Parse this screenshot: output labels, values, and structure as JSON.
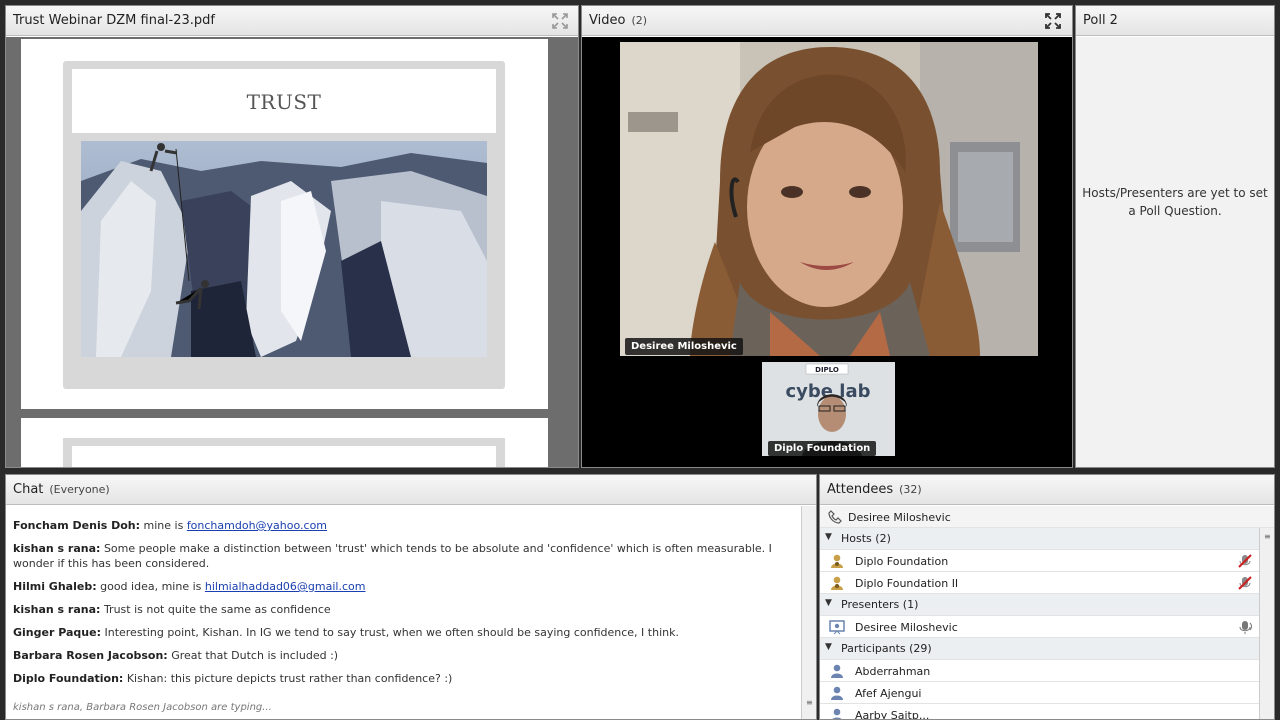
{
  "share_pod": {
    "title": "Trust Webinar DZM final-23.pdf",
    "slide_title": "TRUST"
  },
  "video_pod": {
    "title": "Video",
    "count": "(2)",
    "main_name": "Desiree Miloshevic",
    "thumb_name": "Diplo Foundation",
    "thumb_sign": "cybe lab"
  },
  "poll_pod": {
    "title": "Poll 2",
    "message": "Hosts/Presenters are yet to set a Poll Question."
  },
  "chat_pod": {
    "title": "Chat",
    "scope": "(Everyone)",
    "messages": [
      {
        "sender": "Foncham Denis Doh:",
        "text": "mine is ",
        "link": "fonchamdoh@yahoo.com"
      },
      {
        "sender": "kishan s rana:",
        "text": "Some people make a distinction between 'trust' which tends to be absolute and 'confidence' which is often measurable. I wonder if this has been considered."
      },
      {
        "sender": "Hilmi Ghaleb:",
        "text": "good idea, mine is ",
        "link": "hilmialhaddad06@gmail.com"
      },
      {
        "sender": "kishan s rana:",
        "text": "Trust is not quite the same as confidence"
      },
      {
        "sender": "Ginger Paque:",
        "text": "Interesting point, Kishan. In IG we tend to say trust, when we often should be saying confidence, I think."
      },
      {
        "sender": "Barbara Rosen Jacobson:",
        "text": "Great that Dutch is included :)"
      },
      {
        "sender": "Diplo Foundation:",
        "text": "Kishan: this picture depicts trust rather than confidence? :)"
      }
    ],
    "typing": "kishan s rana, Barbara Rosen Jacobson are typing..."
  },
  "attendees_pod": {
    "title": "Attendees",
    "count": "(32)",
    "active_speaker": "Desiree Miloshevic",
    "hosts_label": "Hosts (2)",
    "hosts": [
      "Diplo Foundation",
      "Diplo Foundation II"
    ],
    "presenters_label": "Presenters (1)",
    "presenters": [
      "Desiree Miloshevic"
    ],
    "participants_label": "Participants (29)",
    "participants": [
      "Abderrahman",
      "Afef Ajengui",
      "Aarby Saitp..."
    ]
  },
  "colors": {
    "link": "#1a3fb0",
    "host_icon": "#c8a04a",
    "user_icon": "#6b84b0",
    "mic_off": "#cc1f1f"
  }
}
